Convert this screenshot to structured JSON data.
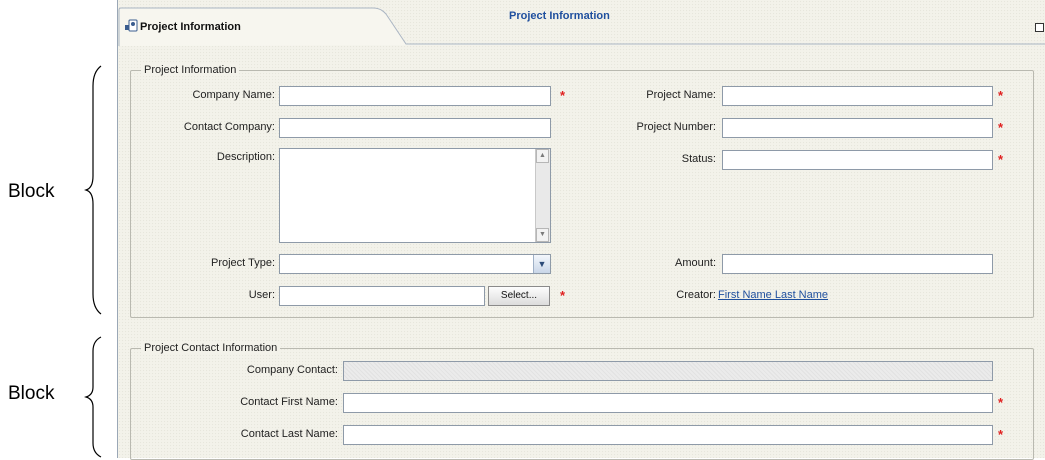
{
  "annotations": {
    "block_1": "Block",
    "block_2": "Block"
  },
  "tabs": {
    "active_title": "Project Information",
    "center_title": "Project Information"
  },
  "icons": {
    "tab_icon": "project-icon",
    "restore_icon": "restore-window-icon"
  },
  "project_info": {
    "legend": "Project Information",
    "company_name_label": "Company Name:",
    "contact_company_label": "Contact Company:",
    "description_label": "Description:",
    "project_type_label": "Project Type:",
    "user_label": "User:",
    "select_button": "Select...",
    "project_name_label": "Project Name:",
    "project_number_label": "Project Number:",
    "status_label": "Status:",
    "amount_label": "Amount:",
    "creator_label": "Creator:",
    "creator_link": "First Name Last Name",
    "required_mark": "*"
  },
  "contact_info": {
    "legend": "Project Contact Information",
    "company_contact_label": "Company Contact:",
    "first_name_label": "Contact First Name:",
    "last_name_label": "Contact Last Name:",
    "required_mark": "*"
  },
  "colors": {
    "required": "#e02020",
    "link": "#1f4f9e",
    "panel_bg": "#f3f2ea"
  }
}
